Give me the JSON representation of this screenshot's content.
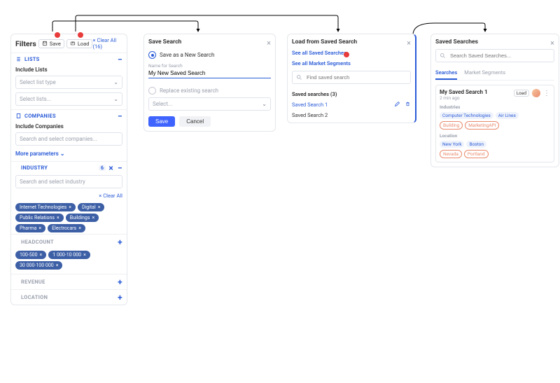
{
  "filters": {
    "title": "Filters",
    "save_label": "Save",
    "load_label": "Load",
    "clear_all": "Clear All (16)",
    "lists_header": "LISTS",
    "include_lists": "Include Lists",
    "list_type_ph": "Select list type",
    "lists_ph": "Select lists...",
    "companies_header": "COMPANIES",
    "include_companies": "Include Companies",
    "companies_ph": "Search and select companies...",
    "more_params": "More parameters",
    "industry_header": "INDUSTRY",
    "industry_count": "6",
    "industry_ph": "Search and select industry",
    "industry_clear": "Clear All",
    "industry_tags": [
      "Internet Technologies",
      "Digital",
      "Public Relations",
      "Buildings",
      "Pharma",
      "Electrocars"
    ],
    "headcount_header": "HEADCOUNT",
    "headcount_tags": [
      "100-500",
      "1 000-10 000",
      "30 000-100 000"
    ],
    "revenue_header": "REVENUE",
    "location_header": "LOCATION"
  },
  "save": {
    "title": "Save Search",
    "opt_new": "Save as a New Search",
    "name_lbl": "Name for Search",
    "name_val": "My New Saved Search",
    "opt_replace": "Replace existing search",
    "select_ph": "Select...",
    "save_btn": "Save",
    "cancel_btn": "Cancel"
  },
  "load": {
    "title": "Load from Saved Search",
    "all_searches": "See all Saved Searches",
    "all_segments": "See all Market Segments",
    "search_ph": "Find saved search",
    "count_label": "Saved searches (3)",
    "rows": [
      "Saved Search 1",
      "Saved Search 2"
    ]
  },
  "ss": {
    "title": "Saved Searches",
    "search_ph": "Search Saved Searches...",
    "tab1": "Searches",
    "tab2": "Market Segments",
    "card": {
      "title": "My Saved Search 1",
      "sub": "2 min ago",
      "load": "Load",
      "grp1": "Industries",
      "grp1_a": [
        "Computer Technologies",
        "Air Lines"
      ],
      "grp1_b": [
        "Building",
        "MarketingAPI"
      ],
      "grp2": "Location",
      "grp2_a": [
        "New York",
        "Boston"
      ],
      "grp2_b": [
        "Nevada",
        "Portland"
      ]
    }
  }
}
